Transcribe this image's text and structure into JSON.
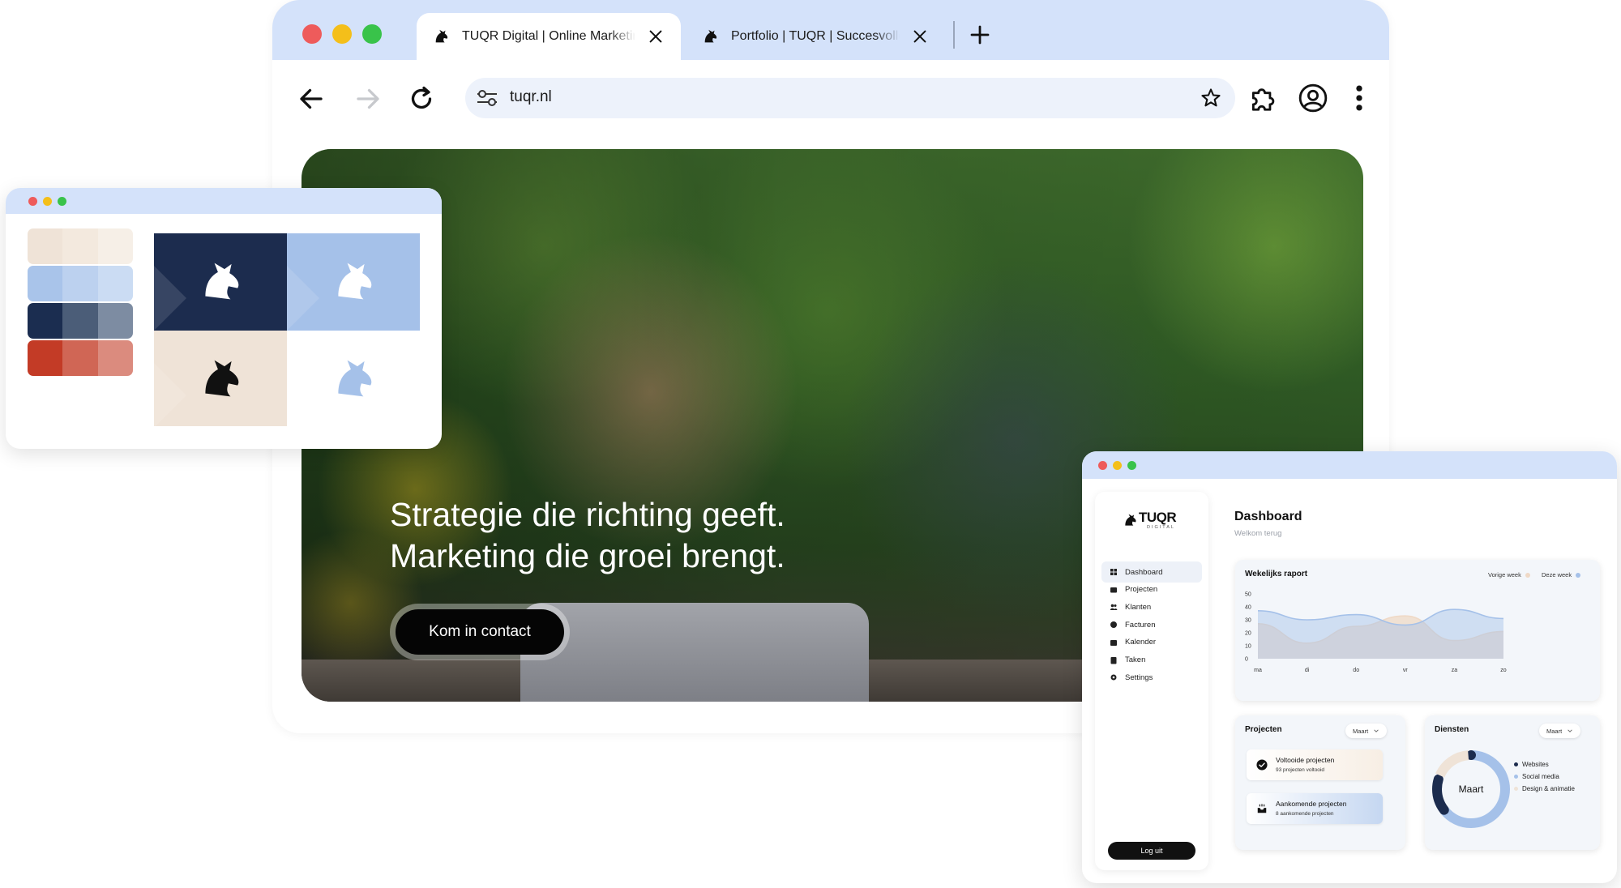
{
  "browser": {
    "tabs": [
      {
        "title": "TUQR Digital | Online Marketing",
        "active": true
      },
      {
        "title": "Portfolio | TUQR | Succesvolle",
        "active": false
      }
    ],
    "url": "tuqr.nl",
    "icons": {
      "back": "arrow-left-icon",
      "forward": "arrow-right-icon",
      "reload": "reload-icon",
      "site_settings": "tune-icon",
      "bookmark": "star-icon",
      "extensions": "puzzle-icon",
      "profile": "account-circle-icon",
      "menu": "more-vertical-icon",
      "new_tab": "plus-icon",
      "close_tab": "close-icon"
    }
  },
  "hero": {
    "headline_line1": "Strategie die richting geeft.",
    "headline_line2": "Marketing die groei brengt.",
    "cta_label": "Kom in contact"
  },
  "palette": {
    "swatches": [
      [
        "#efe3d7",
        "#f3e9de",
        "#f6efe7"
      ],
      [
        "#a9c4ea",
        "#bcd1ef",
        "#cbdcf3"
      ],
      [
        "#1b2d50",
        "#4b5d78",
        "#7d8ca2"
      ],
      [
        "#c33b26",
        "#d06655",
        "#db8b7e"
      ]
    ],
    "logo_tiles": [
      {
        "bg": "#1c2c4e",
        "logo": "#ffffff"
      },
      {
        "bg": "#a5c1e9",
        "logo": "#ffffff"
      },
      {
        "bg": "#efe3d7",
        "logo": "#111111"
      },
      {
        "bg": "#ffffff",
        "logo": "#a5c1e9"
      }
    ]
  },
  "dashboard": {
    "brand": "TUQR",
    "brand_sub": "DIGITAL",
    "title": "Dashboard",
    "subtitle": "Welkom terug",
    "nav": [
      {
        "label": "Dashboard",
        "icon": "grid-icon",
        "active": true
      },
      {
        "label": "Projecten",
        "icon": "folder-icon",
        "active": false
      },
      {
        "label": "Klanten",
        "icon": "users-icon",
        "active": false
      },
      {
        "label": "Facturen",
        "icon": "invoice-icon",
        "active": false
      },
      {
        "label": "Kalender",
        "icon": "calendar-icon",
        "active": false
      },
      {
        "label": "Taken",
        "icon": "tasks-icon",
        "active": false
      },
      {
        "label": "Settings",
        "icon": "gear-icon",
        "active": false
      }
    ],
    "logout_label": "Log uit",
    "weekly": {
      "title": "Wekelijks raport",
      "legend_prev": "Vorige week",
      "legend_current": "Deze week"
    },
    "projects": {
      "title": "Projecten",
      "filter": "Maart",
      "completed_title": "Voltooide projecten",
      "completed_sub": "93 projecten voltooid",
      "upcoming_title": "Aankomende projecten",
      "upcoming_sub": "8 aankomende projecten"
    },
    "services": {
      "title": "Diensten",
      "filter": "Maart",
      "center_label": "Maart",
      "legend": [
        {
          "label": "Websites",
          "color": "#1c2c4e"
        },
        {
          "label": "Social media",
          "color": "#a5c1e9"
        },
        {
          "label": "Design & animatie",
          "color": "#efe3d7"
        }
      ]
    }
  },
  "chart_data": {
    "type": "area",
    "title": "Wekelijks raport",
    "x": [
      "ma",
      "di",
      "do",
      "vr",
      "za",
      "zo"
    ],
    "ylim": [
      0,
      50
    ],
    "yticks": [
      0,
      10,
      20,
      30,
      40,
      50
    ],
    "series": [
      {
        "name": "Vorige week",
        "color": "#efd9c6",
        "values": [
          27,
          12,
          25,
          33,
          14,
          21
        ]
      },
      {
        "name": "Deze week",
        "color": "#a5c1e9",
        "values": [
          37,
          30,
          34,
          26,
          38,
          31
        ]
      }
    ],
    "legend_position": "top-right",
    "grid": false
  }
}
